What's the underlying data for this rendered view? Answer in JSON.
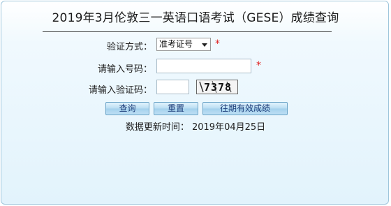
{
  "title": "2019年3月伦敦三一英语口语考试（GESE）成绩查询",
  "form": {
    "method_label": "验证方式：",
    "method_selected": "准考证号",
    "required_mark": "*",
    "number_label": "请输入号码：",
    "number_value": "",
    "captcha_label": "请输入验证码：",
    "captcha_value": "",
    "captcha_text": "7378"
  },
  "buttons": {
    "query": "查询",
    "reset": "重置",
    "past": "往期有效成绩"
  },
  "update": {
    "label": "数据更新时间：",
    "date": "2019年04月25日"
  },
  "colors": {
    "accent_border": "#9fc6dc",
    "required": "#e02020",
    "button_text": "#1d3d7a"
  }
}
